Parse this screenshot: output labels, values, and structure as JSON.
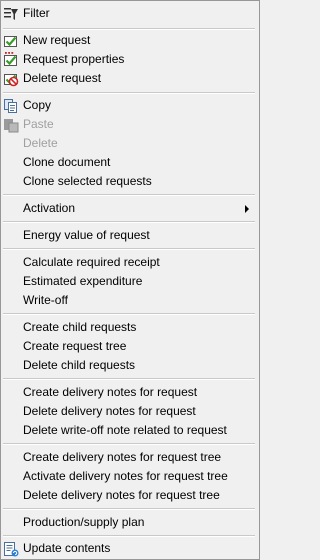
{
  "menu": {
    "filter": {
      "label": "Filter",
      "icon": "filter-icon"
    },
    "new_request": {
      "label": "New request",
      "icon": "new-request-icon"
    },
    "request_properties": {
      "label": "Request properties",
      "icon": "request-properties-icon"
    },
    "delete_request": {
      "label": "Delete request",
      "icon": "delete-request-icon"
    },
    "copy": {
      "label": "Copy",
      "icon": "copy-icon"
    },
    "paste": {
      "label": "Paste",
      "icon": "paste-icon",
      "disabled": true
    },
    "delete": {
      "label": "Delete",
      "disabled": true
    },
    "clone_document": {
      "label": "Clone document"
    },
    "clone_selected_requests": {
      "label": "Clone selected requests"
    },
    "activation": {
      "label": "Activation",
      "has_submenu": true
    },
    "energy_value": {
      "label": "Energy value of request"
    },
    "calculate_required_receipt": {
      "label": "Calculate required receipt"
    },
    "estimated_expenditure": {
      "label": "Estimated expenditure"
    },
    "write_off": {
      "label": "Write-off"
    },
    "create_child_requests": {
      "label": "Create child requests"
    },
    "create_request_tree": {
      "label": "Create request tree"
    },
    "delete_child_requests": {
      "label": "Delete child requests"
    },
    "create_delivery_notes_request": {
      "label": "Create delivery notes for request"
    },
    "delete_delivery_notes_request": {
      "label": "Delete delivery notes for request"
    },
    "delete_write_off_note": {
      "label": "Delete write-off note related to request"
    },
    "create_delivery_notes_tree": {
      "label": "Create delivery notes for request tree"
    },
    "activate_delivery_notes_tree": {
      "label": "Activate delivery notes for request tree"
    },
    "delete_delivery_notes_tree": {
      "label": "Delete delivery notes for request tree"
    },
    "production_supply_plan": {
      "label": "Production/supply plan"
    },
    "update_contents": {
      "label": "Update contents",
      "icon": "update-contents-icon"
    }
  },
  "colors": {
    "background": "#f0f0f0",
    "border": "#979797",
    "separator": "#c9c9c9",
    "disabled_text": "#a0a0a0",
    "check_green": "#3a9a2a",
    "delete_red": "#cc2222"
  }
}
